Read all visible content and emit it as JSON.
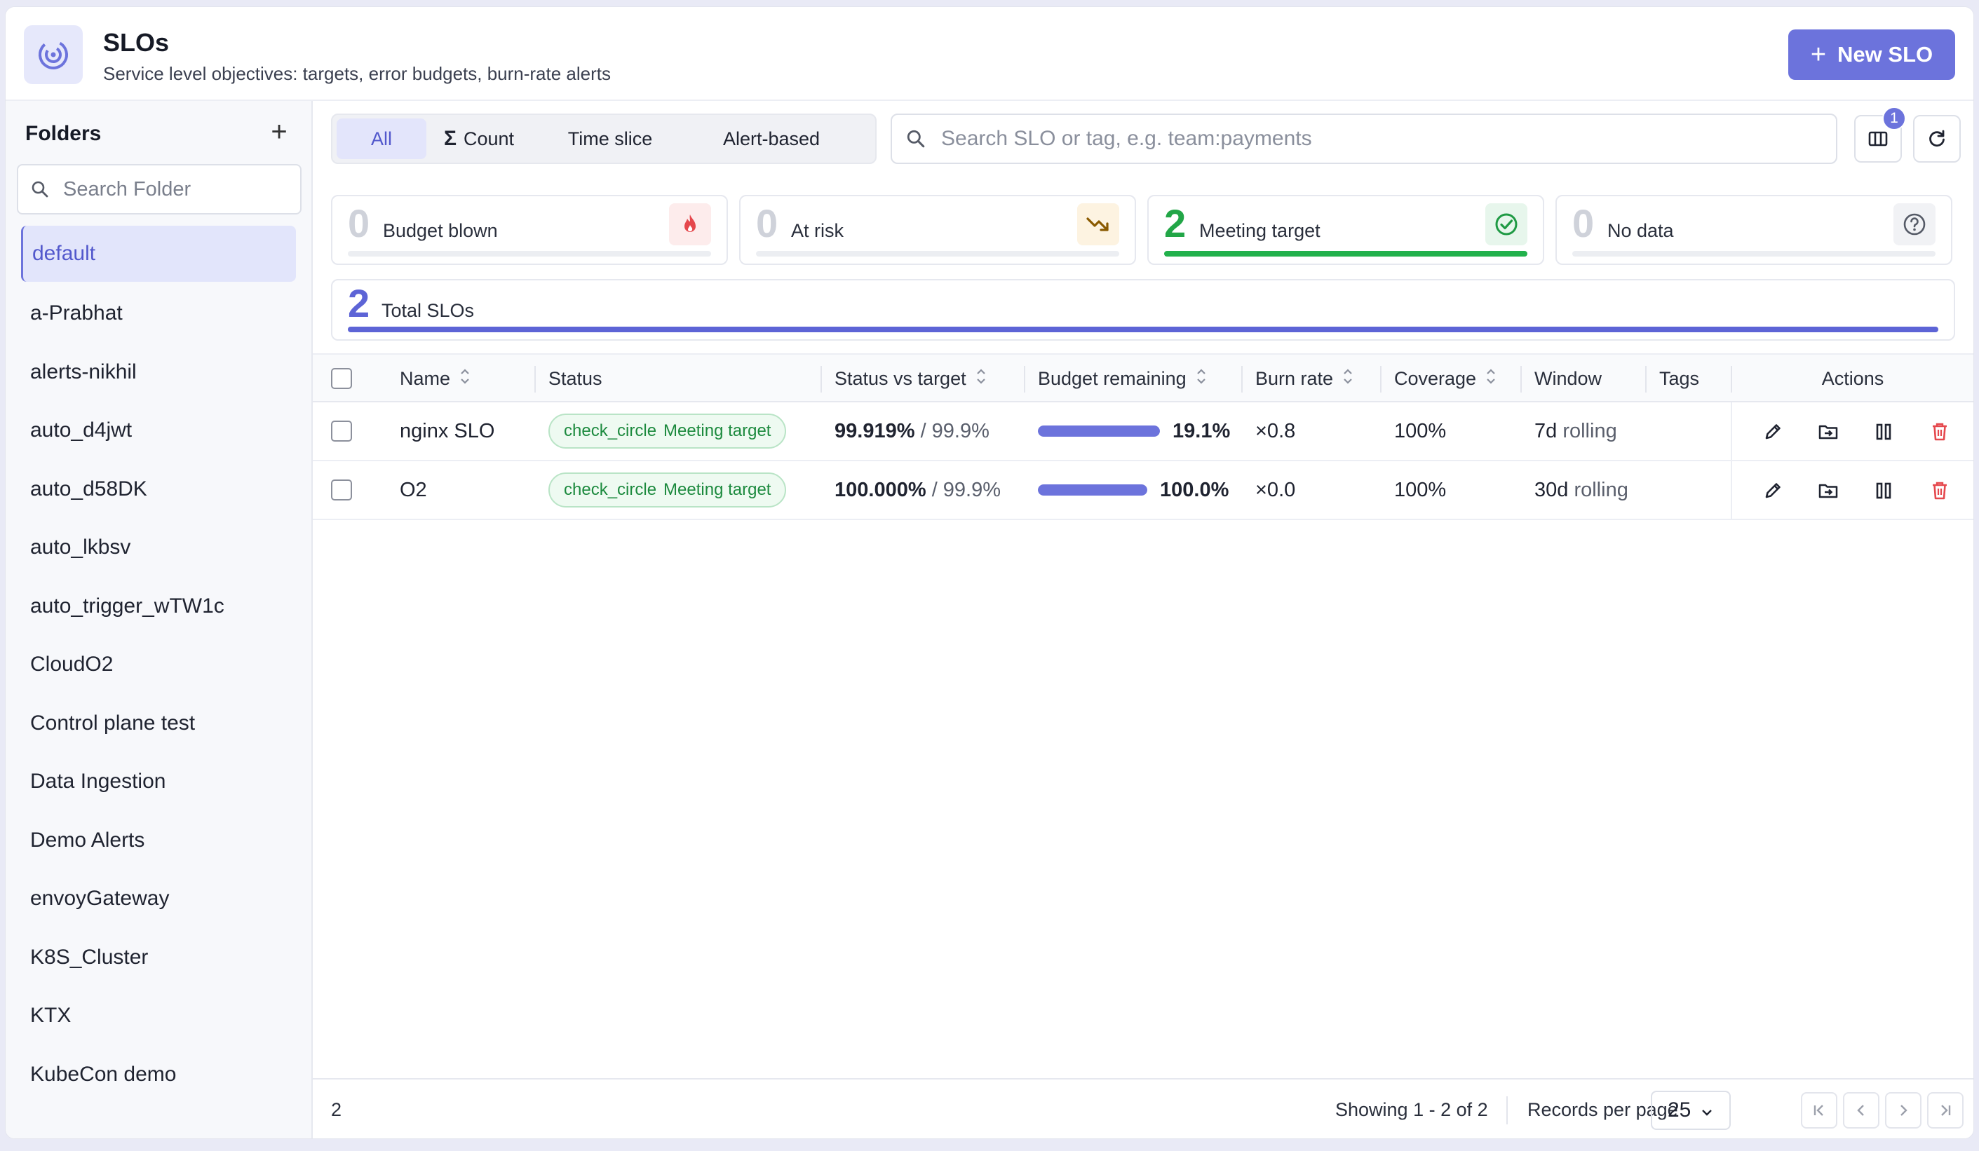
{
  "header": {
    "title": "SLOs",
    "subtitle": "Service level objectives: targets, error budgets, burn-rate alerts",
    "new_button": "New SLO"
  },
  "sidebar": {
    "title": "Folders",
    "search_placeholder": "Search Folder",
    "items": [
      {
        "label": "default",
        "active": true
      },
      {
        "label": "a-Prabhat"
      },
      {
        "label": "alerts-nikhil"
      },
      {
        "label": "auto_d4jwt"
      },
      {
        "label": "auto_d58DK"
      },
      {
        "label": "auto_lkbsv"
      },
      {
        "label": "auto_trigger_wTW1c"
      },
      {
        "label": "CloudO2"
      },
      {
        "label": "Control plane test"
      },
      {
        "label": "Data Ingestion"
      },
      {
        "label": "Demo Alerts"
      },
      {
        "label": "envoyGateway"
      },
      {
        "label": "K8S_Cluster"
      },
      {
        "label": "KTX"
      },
      {
        "label": "KubeCon demo"
      }
    ]
  },
  "filters": {
    "tabs": [
      "All",
      "Count",
      "Time slice",
      "Alert-based"
    ],
    "active_tab": "All",
    "search_placeholder": "Search SLO or tag, e.g. team:payments",
    "columns_badge": "1"
  },
  "stats": [
    {
      "count": "0",
      "label": "Budget blown",
      "icon": "fire-icon",
      "color": "#e5484d"
    },
    {
      "count": "0",
      "label": "At risk",
      "icon": "trending-down-icon",
      "color": "#b26a00"
    },
    {
      "count": "2",
      "label": "Meeting target",
      "icon": "check-circle-icon",
      "color": "#22a647"
    },
    {
      "count": "0",
      "label": "No data",
      "icon": "help-circle-icon",
      "color": "#555a66"
    }
  ],
  "total": {
    "count": "2",
    "label": "Total SLOs"
  },
  "table": {
    "columns": {
      "name": "Name",
      "status": "Status",
      "status_vs_target": "Status vs target",
      "budget_remaining": "Budget remaining",
      "burn_rate": "Burn rate",
      "coverage": "Coverage",
      "window": "Window",
      "tags": "Tags",
      "actions": "Actions"
    },
    "rows": [
      {
        "name": "nginx SLO",
        "status_icon_text": "check_circle",
        "status": "Meeting target",
        "actual": "99.919%",
        "target": "/ 99.9%",
        "budget_fill": 1.0,
        "budget": "19.1%",
        "burn_rate": "×0.8",
        "coverage": "100%",
        "window_value": "7d",
        "window_type": "rolling",
        "tags": ""
      },
      {
        "name": "O2",
        "status_icon_text": "check_circle",
        "status": "Meeting target",
        "actual": "100.000%",
        "target": "/ 99.9%",
        "budget_fill": 1.0,
        "budget": "100.0%",
        "burn_rate": "×0.0",
        "coverage": "100%",
        "window_value": "30d",
        "window_type": "rolling",
        "tags": ""
      }
    ]
  },
  "footer": {
    "count": "2",
    "showing": "Showing 1 - 2 of 2",
    "records_per_page_label": "Records per page",
    "records_per_page": "25"
  }
}
